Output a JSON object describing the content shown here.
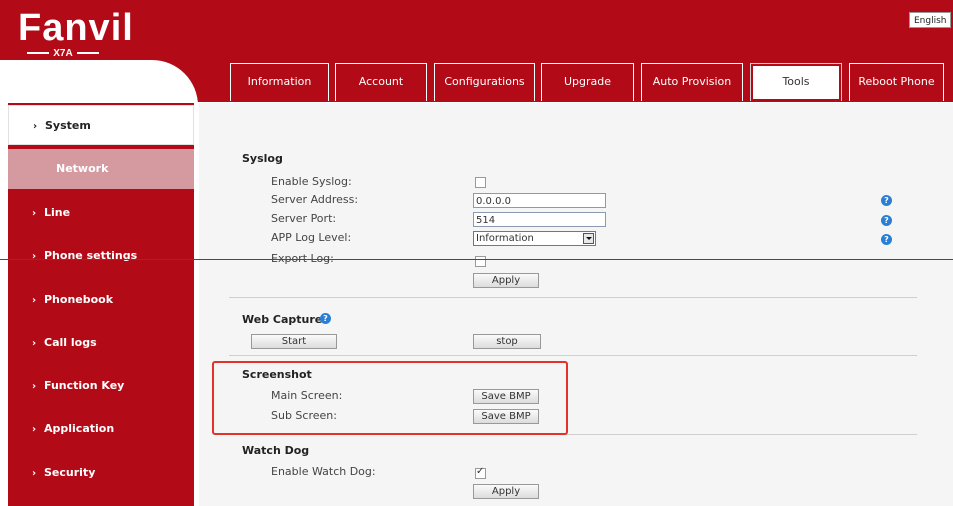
{
  "brand": {
    "logo": "Fanvil",
    "model": "X7A"
  },
  "language": "English",
  "tabs": [
    {
      "label": "Information"
    },
    {
      "label": "Account"
    },
    {
      "label": "Configurations"
    },
    {
      "label": "Upgrade"
    },
    {
      "label": "Auto Provision"
    },
    {
      "label": "Tools",
      "active": true
    },
    {
      "label": "Reboot Phone"
    }
  ],
  "sidebar": {
    "items": [
      {
        "label": "System",
        "active": true
      },
      {
        "label": "Network",
        "sub": true
      },
      {
        "label": "Line"
      },
      {
        "label": "Phone settings"
      },
      {
        "label": "Phonebook"
      },
      {
        "label": "Call logs"
      },
      {
        "label": "Function Key"
      },
      {
        "label": "Application"
      },
      {
        "label": "Security"
      }
    ],
    "chevron": "›"
  },
  "syslog": {
    "title": "Syslog",
    "enable_label": "Enable Syslog:",
    "enable_checked": false,
    "server_address_label": "Server Address:",
    "server_address_value": "0.0.0.0",
    "server_port_label": "Server Port:",
    "server_port_value": "514",
    "app_log_level_label": "APP Log Level:",
    "app_log_level_value": "Information",
    "export_log_label": "Export Log:",
    "apply_label": "Apply"
  },
  "web_capture": {
    "title": "Web Capture",
    "start_label": "Start",
    "stop_label": "stop"
  },
  "screenshot": {
    "title": "Screenshot",
    "main_screen_label": "Main Screen:",
    "sub_screen_label": "Sub Screen:",
    "save_bmp_label": "Save BMP"
  },
  "watch_dog": {
    "title": "Watch Dog",
    "enable_label": "Enable Watch Dog:",
    "enable_checked": true,
    "apply_label": "Apply"
  },
  "help_glyph": "?",
  "colors": {
    "brand_red": "#b20b17",
    "sub_item": "#d59aa0",
    "highlight": "#e2322b",
    "help_blue": "#2a7fd4"
  }
}
